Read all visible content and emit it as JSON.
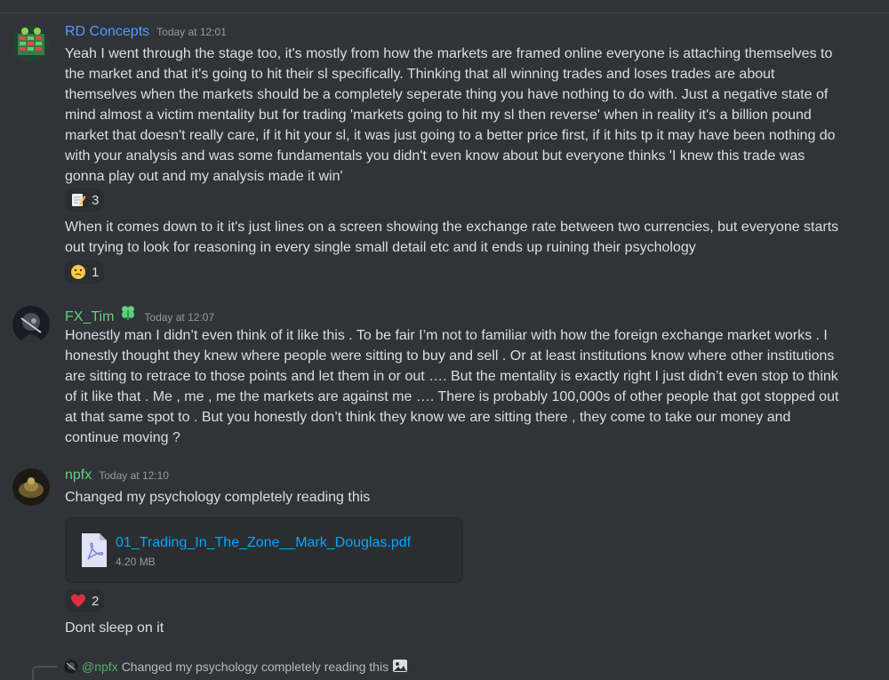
{
  "messages": [
    {
      "username": "RD Concepts",
      "username_color": "#4e9dff",
      "timestamp": "Today at 12:01",
      "paragraphs": [
        "Yeah I went through the stage too, it's mostly from how the markets are framed online everyone is attaching themselves to the market and that it's going to hit their sl specifically. Thinking that all winning trades and loses trades are about themselves when the markets should be a completely seperate thing you have nothing to do with. Just a negative state of mind almost a victim mentality but for trading 'markets going to hit my sl then reverse' when in reality it's a billion pound market that doesn't really care, if it hit your sl, it was just going to a better price first, if it hits tp it may have been nothing do with your analysis and was some fundamentals you didn't even know about but everyone thinks 'I knew this trade was gonna play out and my analysis made it win'",
        "When it comes down to it it's just lines on a screen showing the exchange rate between two currencies, but everyone starts out trying to look for reasoning in every single small detail etc and it ends up ruining their psychology"
      ],
      "reactions": [
        {
          "emoji": "memo-icon",
          "count": "3"
        },
        {
          "emoji": "thinking-face-icon",
          "count": "1"
        }
      ]
    },
    {
      "username": "FX_Tim",
      "username_color": "#5cd17c",
      "timestamp": "Today at 12:07",
      "paragraphs": [
        "Honestly man I didn’t even think of it like this . To be fair I’m not to familiar with how the foreign exchange market works . I honestly thought they knew where people were sitting to buy and sell . Or at least institutions know where other institutions are sitting to retrace to those points and let them in or out …. But the mentality is exactly right I just didn’t even stop to think of it like that . Me , me , me the markets are against me …. There is probably 100,000s of other people that got stopped out at that same spot to . But you honestly don’t think they know we are sitting there , they come to take our money and continue moving ?"
      ]
    },
    {
      "username": "npfx",
      "username_color": "#5cd17c",
      "timestamp": "Today at 12:10",
      "paragraphs": [
        "Changed my psychology completely reading this",
        "Dont sleep on it"
      ],
      "attachment": {
        "name": "01_Trading_In_The_Zone__Mark_Douglas.pdf",
        "size": "4.20 MB",
        "icon": "pdf-file-icon"
      },
      "reactions": [
        {
          "emoji": "red-heart-icon",
          "count": "2"
        }
      ]
    }
  ],
  "reply_preview": {
    "mention": "@npfx",
    "text": "Changed my psychology completely reading this",
    "icon": "image-icon"
  }
}
